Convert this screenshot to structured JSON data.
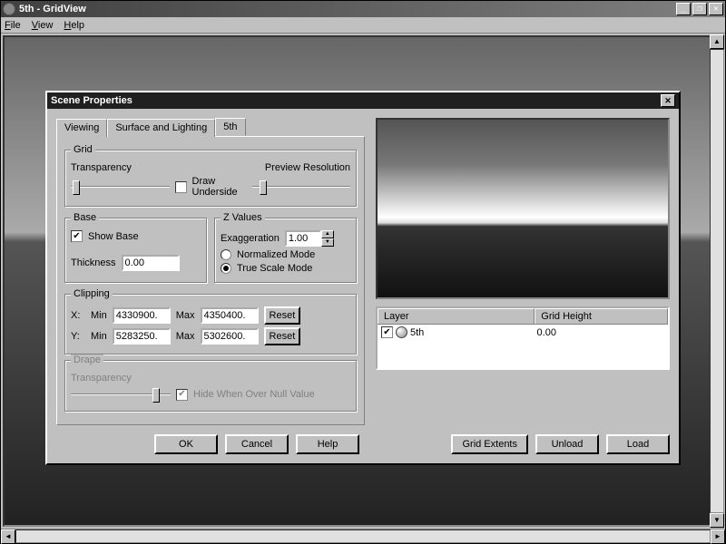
{
  "app": {
    "title": "5th - GridView"
  },
  "menu": {
    "file": "File",
    "view": "View",
    "help": "Help"
  },
  "dialog": {
    "title": "Scene Properties",
    "tabs": {
      "viewing": "Viewing",
      "surface": "Surface and Lighting",
      "current": "5th"
    },
    "grid": {
      "legend": "Grid",
      "transparency": "Transparency",
      "draw_underside": "Draw Underside",
      "preview_resolution": "Preview Resolution"
    },
    "base": {
      "legend": "Base",
      "show_base": "Show Base",
      "thickness_label": "Thickness",
      "thickness_value": "0.00"
    },
    "zvalues": {
      "legend": "Z Values",
      "exaggeration_label": "Exaggeration",
      "exaggeration_value": "1.00",
      "normalized": "Normalized Mode",
      "truescale": "True Scale Mode"
    },
    "clipping": {
      "legend": "Clipping",
      "x_label": "X:",
      "y_label": "Y:",
      "min_label": "Min",
      "max_label": "Max",
      "x_min": "4330900.",
      "x_max": "4350400.",
      "y_min": "5283250.",
      "y_max": "5302600.",
      "reset": "Reset"
    },
    "drape": {
      "legend": "Drape",
      "transparency": "Transparency",
      "hide_null": "Hide When Over Null Value"
    },
    "buttons": {
      "ok": "OK",
      "cancel": "Cancel",
      "help": "Help",
      "grid_extents": "Grid Extents",
      "unload": "Unload",
      "load": "Load"
    },
    "layers": {
      "col_layer": "Layer",
      "col_height": "Grid Height",
      "row": {
        "name": "5th",
        "height": "0.00"
      }
    }
  }
}
